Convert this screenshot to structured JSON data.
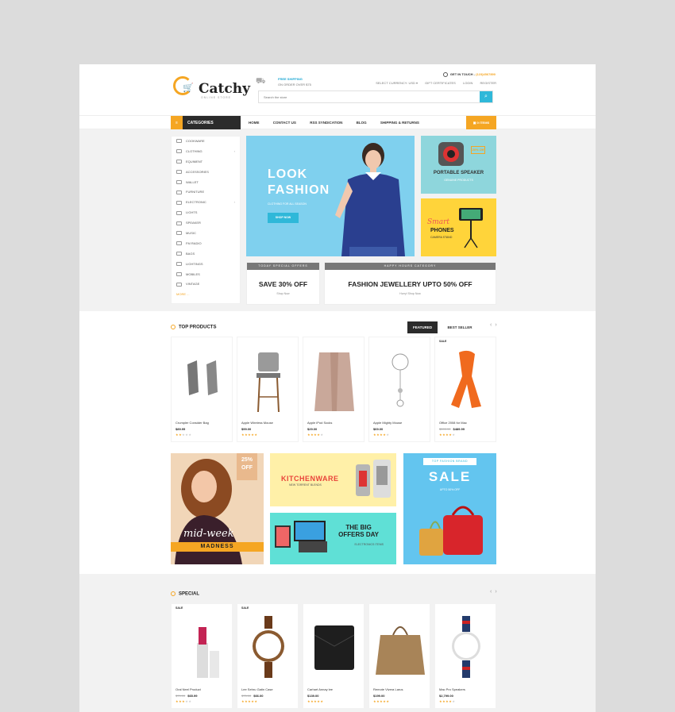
{
  "header": {
    "brand": "Catchy",
    "tagline": "ONLINE STORE",
    "shipping_title": "FREE SHIPPING",
    "shipping_sub": "ON ORDER OVER $75",
    "contact_label": "GET IN TOUCH - ",
    "contact_number": "(123)4567890",
    "top_links": [
      "SELECT CURRENCY: USD ▾",
      "GIFT CERTIFICATES",
      "LOGIN",
      "REGISTER"
    ],
    "search_placeholder": "Search the store"
  },
  "nav": {
    "categories_label": "CATEGORIES",
    "links": [
      "HOME",
      "CONTACT US",
      "RSS SYNDICATION",
      "BLOG",
      "SHIPPING & RETURNS"
    ],
    "cart_label": "0 ITEMS"
  },
  "sidebar": {
    "items": [
      {
        "label": "COOKWARE",
        "arrow": false
      },
      {
        "label": "CLOTHING",
        "arrow": true
      },
      {
        "label": "EQUIMENT",
        "arrow": false
      },
      {
        "label": "ACCESSORIES",
        "arrow": false
      },
      {
        "label": "WALLET",
        "arrow": false
      },
      {
        "label": "FURNITURE",
        "arrow": false
      },
      {
        "label": "ELECTRONIC",
        "arrow": true
      },
      {
        "label": "LIGHTS",
        "arrow": false
      },
      {
        "label": "SPEAKER",
        "arrow": false
      },
      {
        "label": "MUSIC",
        "arrow": false
      },
      {
        "label": "FM RADIO",
        "arrow": false
      },
      {
        "label": "BAGS",
        "arrow": false
      },
      {
        "label": "LIGHTINGS",
        "arrow": false
      },
      {
        "label": "MOBILES",
        "arrow": false
      },
      {
        "label": "VINTAGE",
        "arrow": false
      }
    ],
    "more_label": "MORE ..."
  },
  "hero": {
    "line1": "LOOK",
    "line2": "FASHION",
    "subtitle": "CLOTHING FOR ALL SEASON",
    "button": "SHOP NOW"
  },
  "promos": {
    "speaker_badge": "20% Off",
    "speaker_title": "PORTABLE SPEAKER",
    "speaker_sub": "GENUINE PRODUCTS",
    "phones_script": "Smart",
    "phones_title": "PHONES",
    "phones_sub": "CAMERA STAND"
  },
  "offers": [
    {
      "bar": "TODAY SPECIAL OFFERS",
      "title": "SAVE 30% OFF",
      "sub": "Shop Now"
    },
    {
      "bar": "HAPPY HOURS CATEGORY",
      "title": "FASHION JEWELLERY UPTO 50% OFF",
      "sub": "Hurry! Shop Now"
    }
  ],
  "top_products": {
    "title": "TOP PRODUCTS",
    "tab_active": "FEATURED",
    "tab_other": "BEST SELLER",
    "items": [
      {
        "name": "Crumpler Consider Bag",
        "price": "$89.95",
        "old": "",
        "sale": "",
        "rating": 2
      },
      {
        "name": "Apple Wireless Mouse",
        "price": "$99.00",
        "old": "",
        "sale": "",
        "rating": 5
      },
      {
        "name": "Apple iPod Socks",
        "price": "$29.00",
        "old": "",
        "sale": "",
        "rating": 4
      },
      {
        "name": "Apple Mighty Mouse",
        "price": "$69.00",
        "old": "",
        "sale": "",
        "rating": 4
      },
      {
        "name": "Office 2008 for Mac",
        "price": "$489.99",
        "old": "$599.99",
        "sale": "SALE",
        "rating": 4
      }
    ]
  },
  "banners": {
    "midweek_pct": "25%",
    "midweek_off": "OFF",
    "midweek_script": "mid-week",
    "midweek_title": "MADNESS",
    "kitchen_title": "KITCHENWARE",
    "kitchen_sub": "NEW TORRENT BLENDS",
    "bigoffers_l1": "THE BIG",
    "bigoffers_l2": "OFFERS DAY",
    "bigoffers_sub": "ELECTRONICS ITEMS",
    "sale_tag": "TOP FASHION BRAND",
    "sale_title": "SALE",
    "sale_sub": "UPTO 50% OFF"
  },
  "special": {
    "title": "SPECIAL",
    "items": [
      {
        "name": "Oral Neel Product",
        "price": "$65.99",
        "old": "$79.99",
        "sale": "SALE",
        "rating": 3
      },
      {
        "name": "Lee Sehru Gatin Case",
        "price": "$66.00",
        "old": "$75.00",
        "sale": "SALE",
        "rating": 5
      },
      {
        "name": "Carhart Annay lee",
        "price": "$139.00",
        "old": "",
        "sale": "",
        "rating": 5
      },
      {
        "name": "Remote Vivera Larus",
        "price": "$199.00",
        "old": "",
        "sale": "",
        "rating": 5
      },
      {
        "name": "Mac Pro Speakers",
        "price": "$2,799.00",
        "old": "",
        "sale": "",
        "rating": 4
      }
    ]
  },
  "colors": {
    "accent": "#f5a623",
    "blue": "#2fb8d9",
    "dark": "#2b2b2b"
  }
}
